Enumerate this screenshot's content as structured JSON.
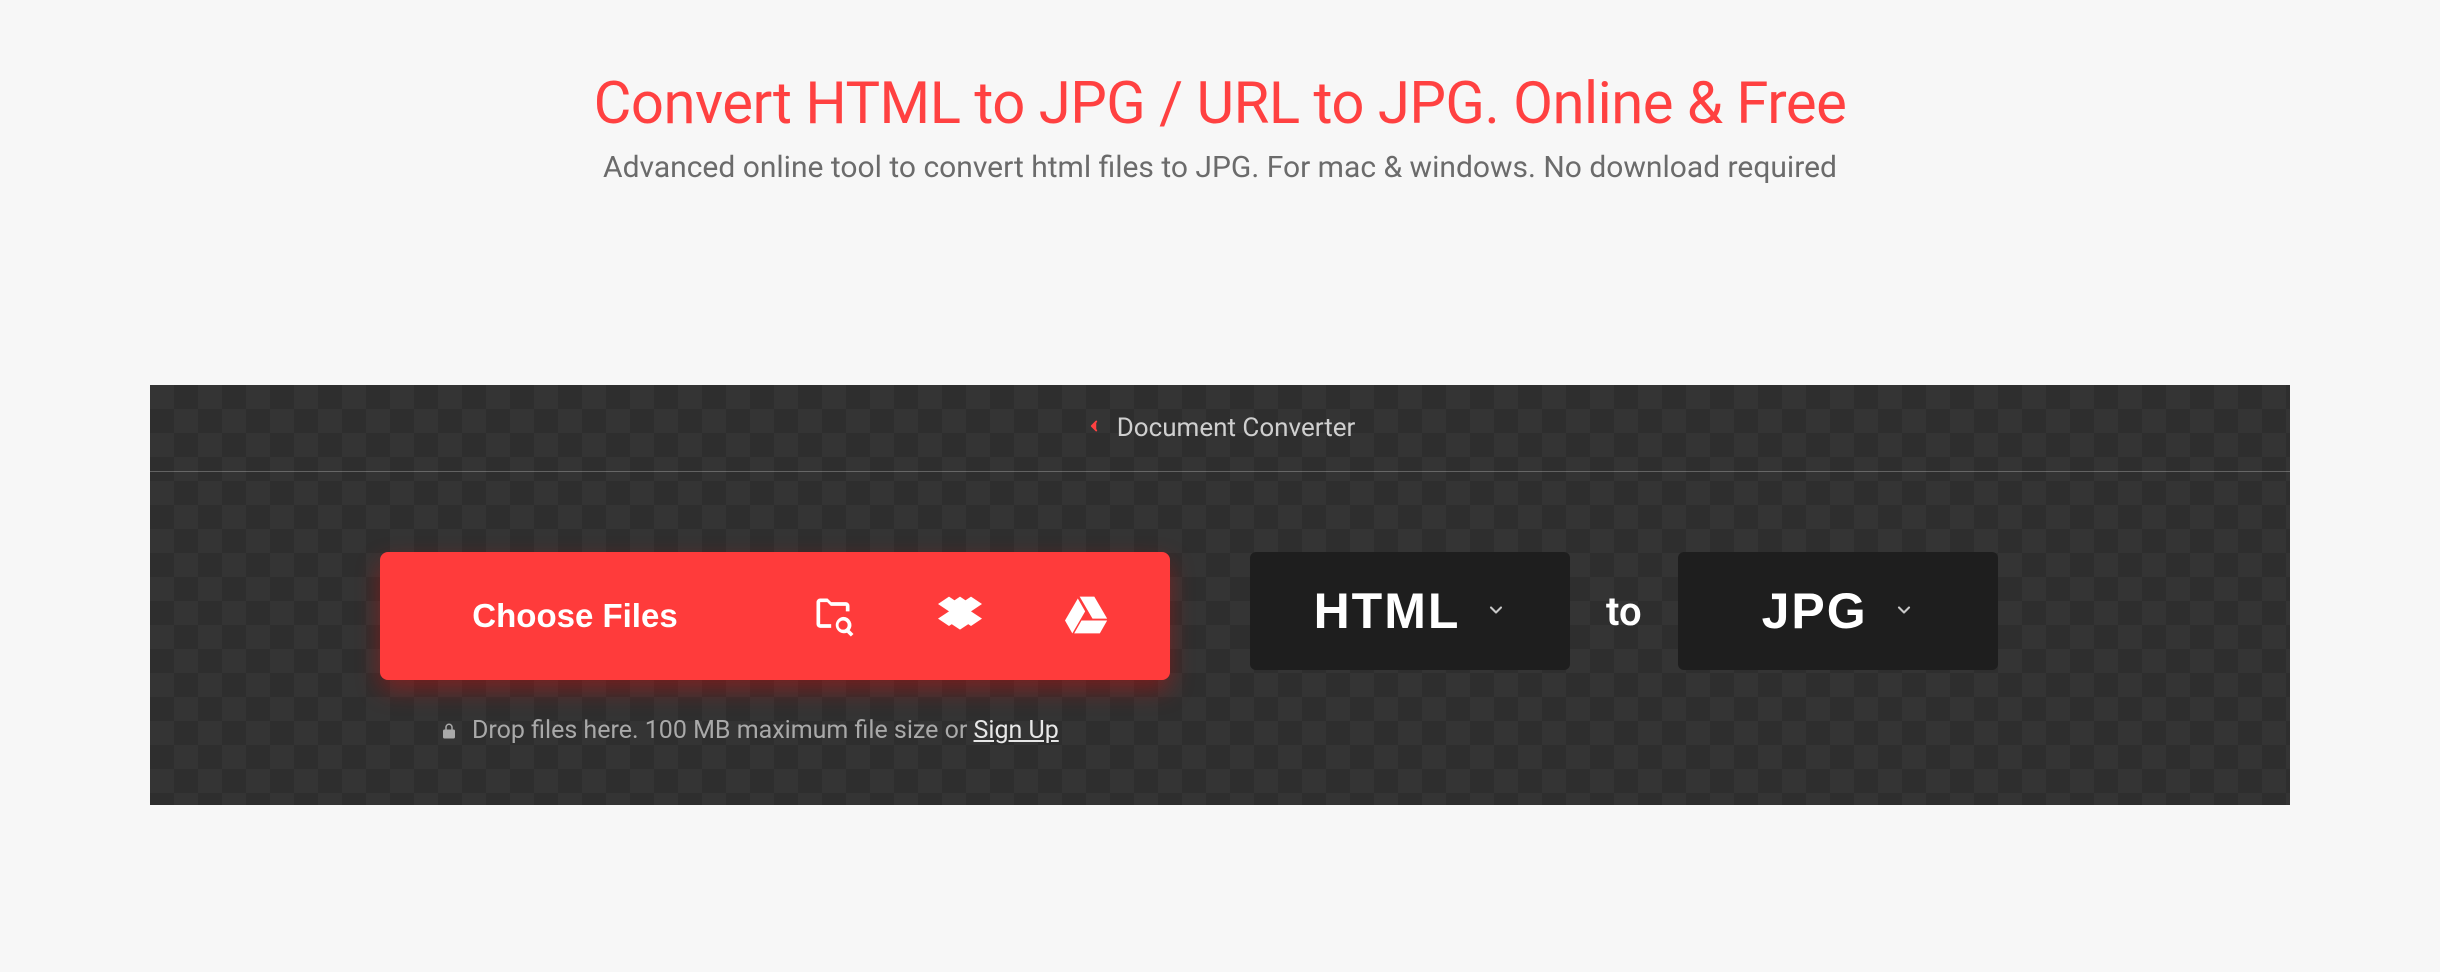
{
  "header": {
    "title": "Convert HTML to JPG / URL to JPG. Online & Free",
    "subtitle": "Advanced online tool to convert html files to JPG. For mac & windows. No download required"
  },
  "breadcrumb": {
    "label": "Document Converter"
  },
  "upload": {
    "choose_label": "Choose Files",
    "hint_text": "Drop files here. 100 MB maximum file size or ",
    "signup_label": "Sign Up"
  },
  "format": {
    "from": "HTML",
    "separator": "to",
    "to": "JPG"
  },
  "icons": {
    "folder": "folder-search-icon",
    "dropbox": "dropbox-icon",
    "drive": "google-drive-icon",
    "lock": "lock-icon",
    "chevron_left": "chevron-left-icon",
    "chevron_down": "chevron-down-icon"
  }
}
